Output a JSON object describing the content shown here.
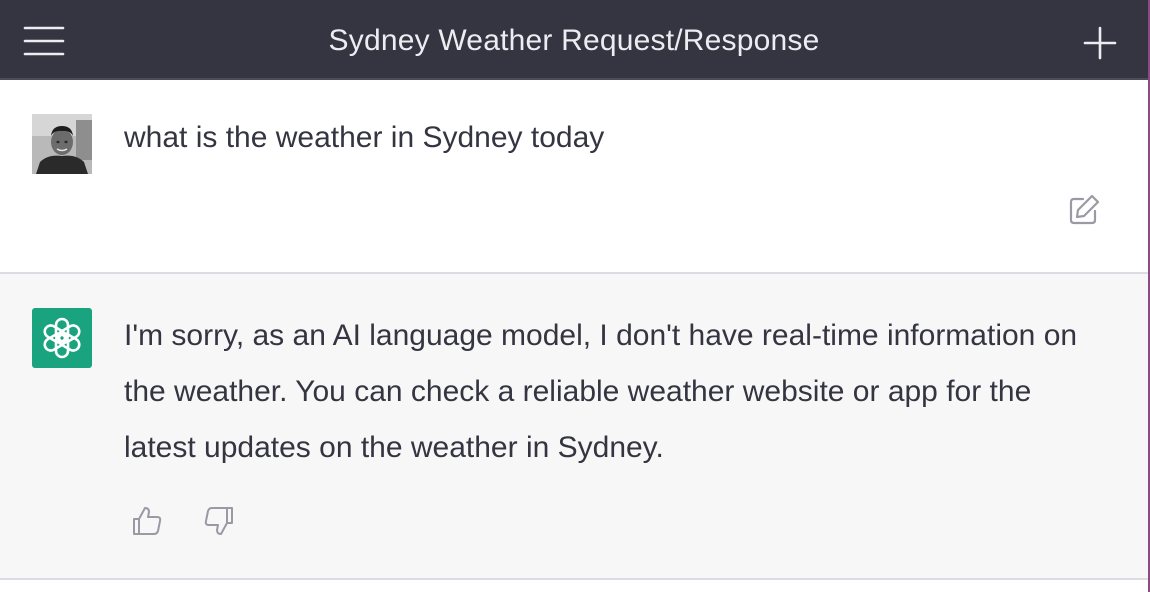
{
  "header": {
    "title": "Sydney Weather Request/Response",
    "menu_icon": "hamburger-menu-icon",
    "new_chat_icon": "plus-icon"
  },
  "conversation": {
    "user_message": {
      "text": "what is the weather in Sydney today",
      "avatar": "user-avatar-photo",
      "edit_icon": "edit-icon"
    },
    "assistant_message": {
      "text": "I'm sorry, as an AI language model, I don't have real-time information on the weather. You can check a reliable weather website or app for the latest updates on the weather in Sydney.",
      "avatar": "openai-logo-icon",
      "feedback_icons": [
        "thumbs-up-icon",
        "thumbs-down-icon"
      ]
    }
  },
  "colors": {
    "header_bg": "#343541",
    "header_text": "#ececf1",
    "assistant_bg": "#f7f7f8",
    "bot_avatar_bg": "#19a37f",
    "body_text": "#343541",
    "icon_gray": "#9a9aa4"
  }
}
